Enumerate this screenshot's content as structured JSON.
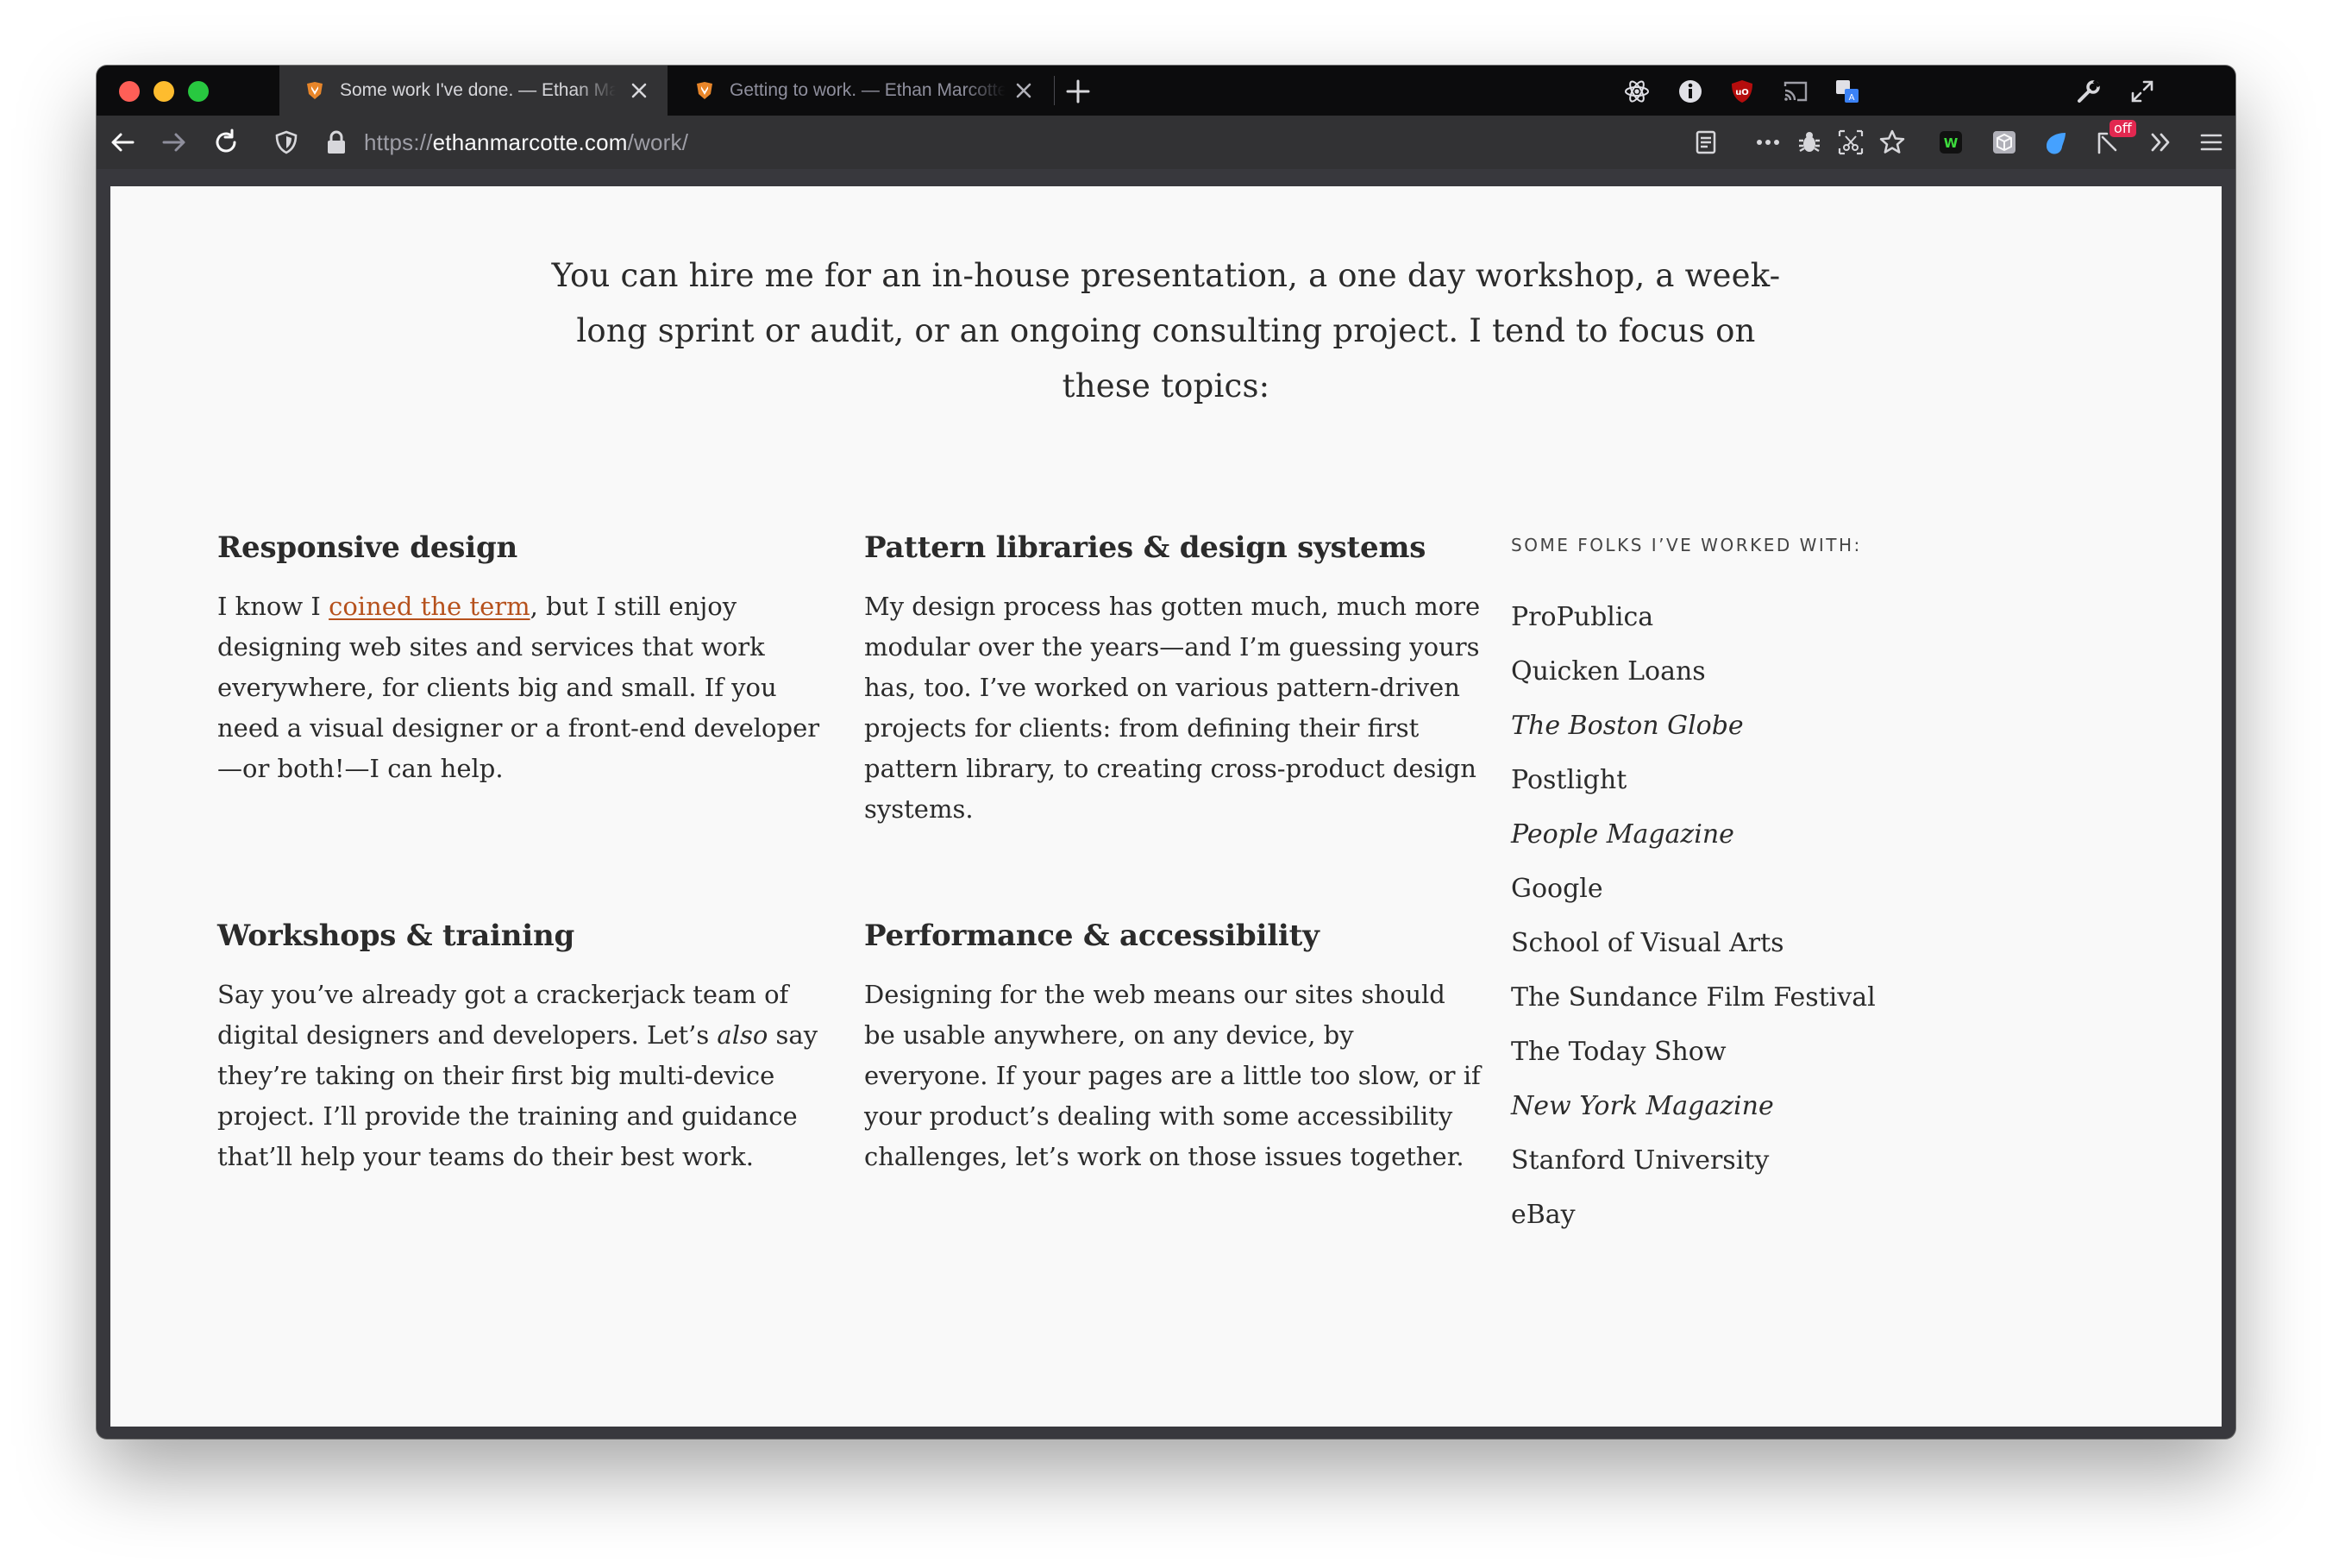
{
  "browser": {
    "tabs": [
      {
        "title": "Some work I've done. — Ethan Marcotte",
        "active": true
      },
      {
        "title": "Getting to work. — Ethan Marcotte",
        "active": false
      }
    ],
    "url": {
      "scheme": "https://",
      "host": "ethanmarcotte.com",
      "path": "/work/"
    },
    "toolbar_icons": [
      "back-icon",
      "forward-icon",
      "reload-icon",
      "tracking-shield-icon",
      "lock-icon",
      "reader-view-icon",
      "page-actions-icon",
      "bug-icon",
      "screenshot-icon",
      "bookmark-star-icon",
      "w-extension-icon",
      "cube-extension-icon",
      "water-drop-extension-icon",
      "cursor-extension-icon",
      "overflow-chevrons-icon",
      "hamburger-menu-icon"
    ],
    "tabstrip_icons": [
      "react-devtools-icon",
      "info-extension-icon",
      "ublock-icon",
      "cast-icon",
      "translate-icon",
      "wrench-icon",
      "fullscreen-icon"
    ],
    "badge_off": "off",
    "ublock_label": "uO",
    "w_label": "W",
    "colors": {
      "accent_link": "#b6511c",
      "page_bg": "#f9f9f9",
      "chrome_dark": "#0c0c0d"
    }
  },
  "page": {
    "intro": "You can hire me for an in-house presentation, a one day workshop, a week-long sprint or audit, or an ongoing consulting project. I tend to focus on these topics:",
    "sections": {
      "responsive": {
        "heading": "Responsive design",
        "before": "I know I ",
        "link": "coined the term",
        "after": ", but I still enjoy designing web sites and services that work everywhere, for clients big and small. If you need a visual designer or a front-end developer—or both!—I can help."
      },
      "patterns": {
        "heading": "Pattern libraries & design systems",
        "body": "My design process has gotten much, much more modular over the years—and I’m guessing yours has, too. I’ve worked on various pattern-driven projects for clients: from defining their first pattern library, to creating cross-product design systems."
      },
      "workshops": {
        "heading": "Workshops & training",
        "before": "Say you’ve already got a crackerjack team of digital designers and developers. Let’s ",
        "em": "also",
        "after": " say they’re taking on their first big multi-device project. I’ll provide the training and guidance that’ll help your teams do their best work."
      },
      "performance": {
        "heading": "Performance & accessibility",
        "body": "Designing for the web means our sites should be usable anywhere, on any device, by everyone. If your pages are a little too slow, or if your product’s dealing with some accessibility challenges, let’s work on those issues together."
      }
    },
    "clients": {
      "label": "SOME FOLKS I’VE WORKED WITH:",
      "items": [
        "ProPublica",
        "Quicken Loans",
        "The Boston Globe",
        "Postlight",
        "People Magazine",
        "Google",
        "School of Visual Arts",
        "The Sundance Film Festival",
        "The Today Show",
        "New York Magazine",
        "Stanford University",
        "eBay"
      ]
    }
  }
}
